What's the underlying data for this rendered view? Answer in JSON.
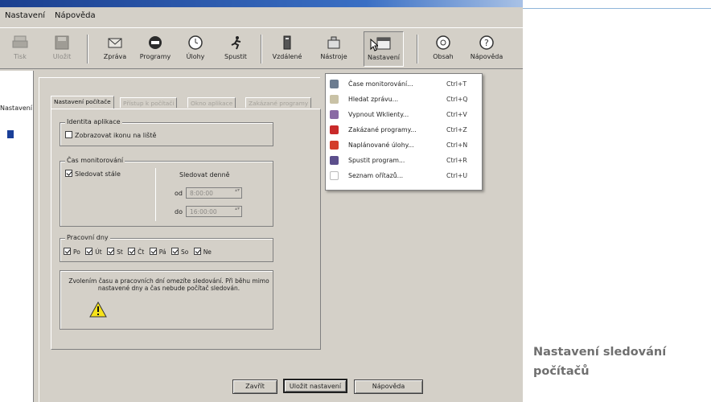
{
  "menubar": {
    "items": [
      "Nastavení",
      "Nápověda"
    ]
  },
  "toolbar": {
    "buttons": [
      {
        "label": "Tisk",
        "icon": "printer-icon",
        "disabled": true
      },
      {
        "label": "Uložit",
        "icon": "save-icon",
        "disabled": true
      },
      {
        "label": "Zpráva",
        "icon": "mail-icon",
        "disabled": false
      },
      {
        "label": "Programy",
        "icon": "stop-icon",
        "disabled": false
      },
      {
        "label": "Úlohy",
        "icon": "clock-icon",
        "disabled": false
      },
      {
        "label": "Spustit",
        "icon": "run-icon",
        "disabled": false
      },
      {
        "label": "Vzdálené",
        "icon": "server-icon",
        "disabled": false
      },
      {
        "label": "Nástroje",
        "icon": "tools-icon",
        "disabled": false
      },
      {
        "label": "Nastavení",
        "icon": "settings-window-icon",
        "disabled": false,
        "pressed": true
      },
      {
        "label": "Obsah",
        "icon": "help-contents-icon",
        "disabled": false
      },
      {
        "label": "Nápověda",
        "icon": "help-icon",
        "disabled": false
      }
    ]
  },
  "left_panel": {
    "label": "Nastavení"
  },
  "dialog": {
    "tabs": [
      "Nastavení počítače",
      "Přístup k počítači",
      "Okno aplikace",
      "Zakázané programy"
    ],
    "group_identity": {
      "title": "Identita aplikace",
      "checkbox_label": "Zobrazovat ikonu na liště",
      "checked": false
    },
    "group_time": {
      "title": "Čas monitorování",
      "checkbox_label": "Sledovat stále",
      "checked": true,
      "right_title": "Sledovat denně",
      "from_label": "od",
      "from_value": "8:00:00",
      "to_label": "do",
      "to_value": "16:00:00"
    },
    "group_days": {
      "title": "Pracovní dny",
      "days": [
        {
          "label": "Po",
          "checked": true
        },
        {
          "label": "Út",
          "checked": true
        },
        {
          "label": "St",
          "checked": true
        },
        {
          "label": "Čt",
          "checked": true
        },
        {
          "label": "Pá",
          "checked": true
        },
        {
          "label": "So",
          "checked": true
        },
        {
          "label": "Ne",
          "checked": true
        }
      ]
    },
    "warning": {
      "text": "Zvolením času a pracovních dní omezíte sledování. Při běhu mimo nastavené dny a čas nebude počítač sledován."
    },
    "buttons": {
      "close": "Zavřít",
      "save": "Uložit nastavení",
      "help": "Nápověda"
    }
  },
  "popup_menu": {
    "items": [
      {
        "label": "Čase monitorování...",
        "shortcut": "Ctrl+T",
        "icon": "clock-icon",
        "color": "#6c7c90"
      },
      {
        "label": "Hledat zprávu...",
        "shortcut": "Ctrl+Q",
        "icon": "search-message-icon",
        "color": "#c9c2a6"
      },
      {
        "label": "Vypnout Wklienty...",
        "shortcut": "Ctrl+V",
        "icon": "power-icon",
        "color": "#8a6aa4"
      },
      {
        "label": "Zakázané programy...",
        "shortcut": "Ctrl+Z",
        "icon": "stop-icon",
        "color": "#c92a2a"
      },
      {
        "label": "Naplánované úlohy...",
        "shortcut": "Ctrl+N",
        "icon": "clock-red-icon",
        "color": "#d33d2a"
      },
      {
        "label": "Spustit program...",
        "shortcut": "Ctrl+R",
        "icon": "run-icon",
        "color": "#5c4f8c"
      },
      {
        "label": "Seznam ořítazů...",
        "shortcut": "Ctrl+U",
        "icon": "list-icon",
        "color": "#ffffff"
      }
    ]
  },
  "caption": {
    "line1": "Nastavení sledování",
    "line2": "počítačů"
  },
  "colors": {
    "window_bg": "#d4d0c8",
    "title_blue": "#1b3f8f",
    "caption_text": "#6f6f6f",
    "rule": "#8fb6da"
  }
}
